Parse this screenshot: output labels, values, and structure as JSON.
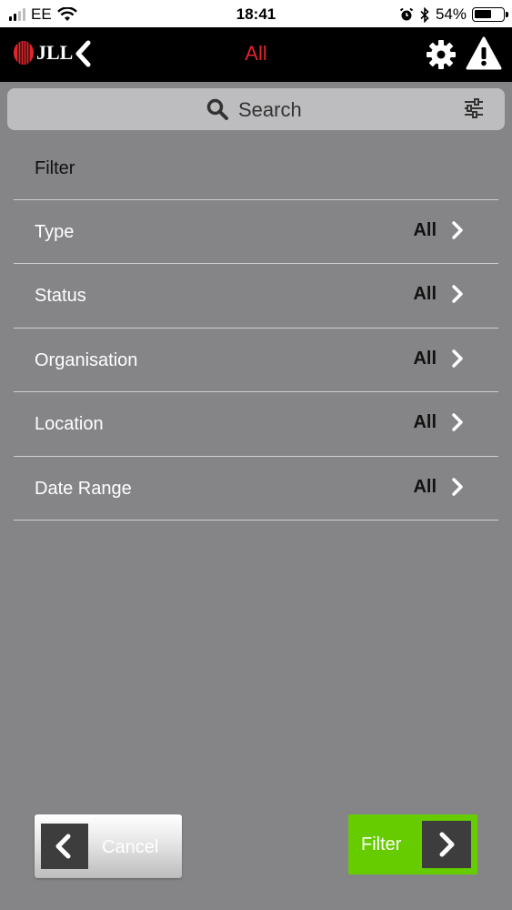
{
  "status_bar": {
    "carrier": "EE",
    "time": "18:41",
    "battery": "54%",
    "icons": [
      "signal-icon",
      "wifi-icon",
      "alarm-icon",
      "bluetooth-icon",
      "battery-icon"
    ]
  },
  "header": {
    "logo_text": "JLL",
    "title": "All",
    "title_color": "#e1262b",
    "icons": [
      "back-chevron-icon",
      "gear-icon",
      "warning-icon"
    ]
  },
  "search": {
    "label": "Search",
    "icons": [
      "search-icon",
      "filter-sliders-icon"
    ]
  },
  "filter": {
    "heading": "Filter",
    "rows": [
      {
        "label": "Type",
        "value": "All"
      },
      {
        "label": "Status",
        "value": "All"
      },
      {
        "label": "Organisation",
        "value": "All"
      },
      {
        "label": "Location",
        "value": "All"
      },
      {
        "label": "Date Range",
        "value": "All"
      }
    ]
  },
  "footer": {
    "cancel_label": "Cancel",
    "filter_label": "Filter",
    "accent_color": "#66cc00"
  }
}
